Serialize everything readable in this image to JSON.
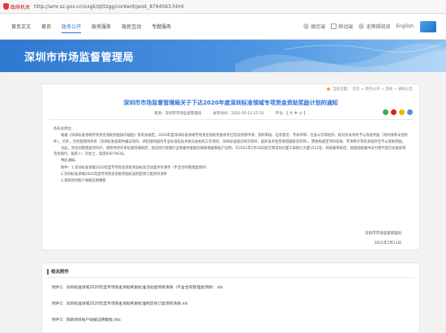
{
  "browser": {
    "badge": "政府机关",
    "url": "http://amr.sz.gov.cn/xxgk/qt/tzgg/content/post_8764563.html"
  },
  "nav": {
    "items": [
      "首页正文",
      "首页",
      "政务公开",
      "政务服务",
      "政民互动",
      "专题服务"
    ],
    "active_index": 2,
    "tools": [
      "微信端",
      "移动端",
      "无障碍阅读",
      "English"
    ]
  },
  "banner": {
    "title": "深圳市市场监督管理局"
  },
  "breadcrumb": [
    "当前位置：",
    "首页",
    "政务公开",
    "其他",
    "通知公告"
  ],
  "doc": {
    "title": "深圳市市场监督管理局关于下达2020年度深圳标准领域专项资金资助奖励计划的通知",
    "source": "来源：深圳市市场监督管理局",
    "date": "发布时间：2021-05-12 15:32",
    "font": "字号：【 大  中  小 】",
    "salutation": "各有关单位：",
    "p1": "根据《深圳标准领域专项资金资助奖励操作规程》等有关规定，2020年度深圳标准领域专项资金资助奖励项目已完成受理申请、资料审核、征求意见、专家评审、社会公示等程序，现对有关项目予以资助奖励（项目清单详见附件）。另外，合同管理项目目（深圳标准指南件编法项目、承担国际国内专业标准化技术委员会机构工作项目、深圳标准国企研究项目、国外技术性贸易措施研究项目），需依照规定项目验收、专项审计等有关程序后予以资助奖励。",
    "p2": "为此，资合同管理类项目外，请附件所列单位收到通知后，按实际计划银行业款备件套服的收款收据和账户证明，于2021年5月18日前交到深圳大厦工商街行大厦1512室，经核报审核后，按照国家集中支付管代理方式直接将资金拨付。联系人：刘女士，电话83070636。",
    "closing": "特此通知。",
    "attachments_intro": "附件：1.深圳标准领域2020年度专项资金资助奖励标准活动类项目清单（不含合同管理类项目）",
    "attachment_line2": "2.深圳标准领域2020年度专项资金资助奖励标准制定修订类项目清单",
    "attachment_line3": "3.资助项目账户收据证明模板",
    "signer": "深圳市市场监督管理局",
    "sign_date": "2021年5月11日"
  },
  "attachments": {
    "heading": "相关附件",
    "items": [
      "附件1：深圳标准领域2020年度专项资金资助奖励标准活动类项目清单（不含合同管理类项目）.xls",
      "附件2：深圳标准领域2020年度专项资金资助奖励标准制定修订类项目清单.xls",
      "附件3：资助项目账户收据证明模板.doc"
    ]
  },
  "colors": {
    "accent": "#2a6fd6",
    "banner_start": "#2f78d0",
    "banner_end": "#89c0ef",
    "share_wechat": "#3cb034",
    "share_weibo": "#e6162d",
    "share_qzone": "#f5b400",
    "share_more": "#4a90e2"
  },
  "icons": [
    "gov-shield-icon",
    "wechat-icon",
    "mobile-icon",
    "accessibility-icon",
    "site-logo",
    "share-wechat-icon",
    "share-weibo-icon",
    "share-qzone-icon",
    "share-more-icon",
    "breadcrumb-location-icon"
  ]
}
